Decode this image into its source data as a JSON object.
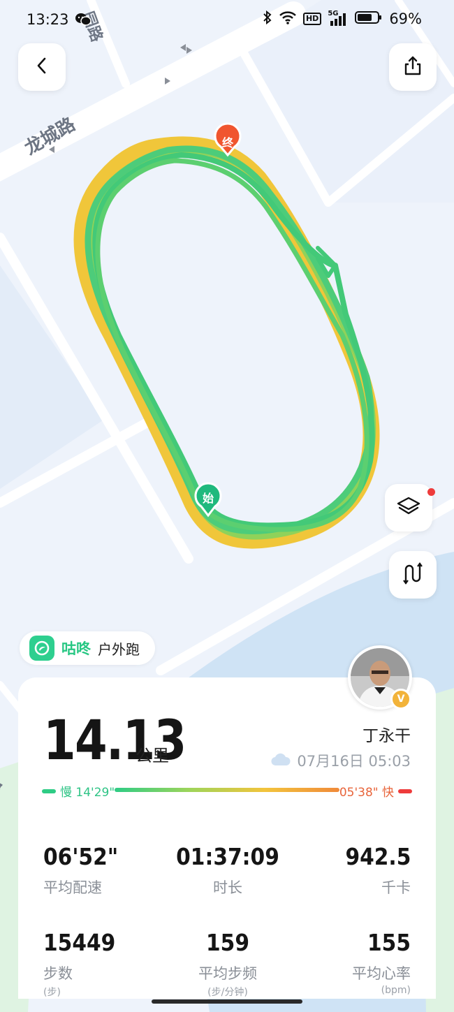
{
  "status_bar": {
    "time": "13:23",
    "battery_percent": "69%",
    "hd_label": "HD",
    "network_label": "5G",
    "icons": [
      "wechat-icon",
      "bluetooth-icon",
      "wifi-icon",
      "signal-icon",
      "battery-icon"
    ]
  },
  "map": {
    "road_labels": [
      "龙城路",
      "园路",
      "路"
    ],
    "start_marker": "始",
    "end_marker": "终",
    "colors": {
      "route_green": "#4dcc7a",
      "route_yellow": "#f0c63a",
      "start": "#1fb97d",
      "end": "#f0552f",
      "water": "#cfe3f5"
    }
  },
  "buttons": {
    "back": "back-icon",
    "share": "share-icon",
    "layers": "layers-icon",
    "route": "route-icon",
    "layers_has_notification": true
  },
  "brand": {
    "name": "咕咚",
    "activity": "户外跑",
    "accent": "#27c783"
  },
  "summary": {
    "distance": "14.13",
    "distance_unit": "公里",
    "user_name": "丁永干",
    "date": "07月16日 05:03",
    "weather_icon": "cloud-icon",
    "verified_badge": "V"
  },
  "pace_legend": {
    "slow_label": "慢 14'29\"",
    "fast_label": "05'38\" 快"
  },
  "stats": [
    {
      "value": "06'52\"",
      "label": "平均配速"
    },
    {
      "value": "01:37:09",
      "label": "时长"
    },
    {
      "value": "942.5",
      "label": "千卡"
    },
    {
      "value": "15449",
      "label": "步数",
      "sub": "(步)"
    },
    {
      "value": "159",
      "label": "平均步频",
      "sub": "(步/分钟)"
    },
    {
      "value": "155",
      "label": "平均心率",
      "sub": "(bpm)"
    }
  ]
}
